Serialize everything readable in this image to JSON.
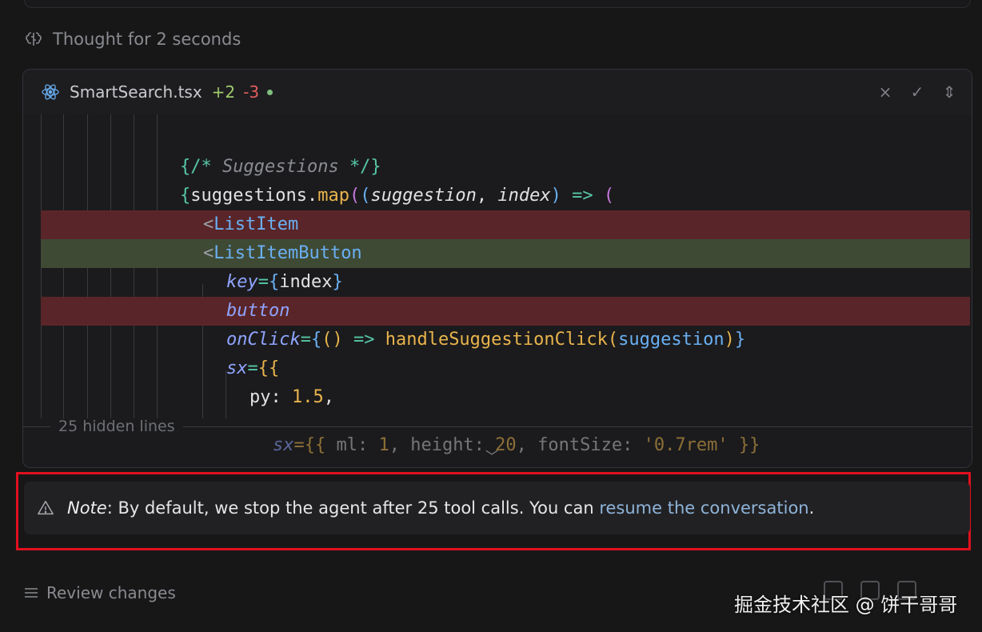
{
  "thought": {
    "label": "Thought for 2 seconds",
    "icon": "brain-icon"
  },
  "editor": {
    "file_name": "SmartSearch.tsx",
    "additions": "+2",
    "deletions": "-3",
    "actions": {
      "reject": "×",
      "accept": "✓",
      "expand": "⇕"
    }
  },
  "code": {
    "l1_a": "{/*",
    "l1_b": " Suggestions ",
    "l1_c": "*/}",
    "l2_a": "{",
    "l2_b": "suggestions.",
    "l2_c": "map",
    "l2_d": "(",
    "l2_e": "(",
    "l2_f": "suggestion",
    "l2_g": ", ",
    "l2_h": "index",
    "l2_i": ")",
    "l2_j": " => ",
    "l2_k": "(",
    "l3_a": "<",
    "l3_b": "ListItem",
    "l4_a": "<",
    "l4_b": "ListItemButton",
    "l5_a": "key",
    "l5_b": "=",
    "l5_c": "{",
    "l5_d": "index",
    "l5_e": "}",
    "l6_a": "button",
    "l7_a": "onClick",
    "l7_b": "=",
    "l7_c": "{",
    "l7_d": "() ",
    "l7_e": "=> ",
    "l7_f": "handleSuggestionClick",
    "l7_g": "(",
    "l7_h": "suggestion",
    "l7_i": ")",
    "l7_j": "}",
    "l8_a": "sx",
    "l8_b": "=",
    "l8_c": "{{",
    "l9_a": "py: ",
    "l9_b": "1.5",
    "l9_c": ",",
    "hidden_label": "25 hidden lines",
    "faded_a": "sx",
    "faded_b": "={{ ",
    "faded_c": "ml: ",
    "faded_d": "1",
    "faded_e": ", height: ",
    "faded_f": "20",
    "faded_g": ", fontSize: ",
    "faded_h": "'0.7rem'",
    "faded_i": " }}"
  },
  "note": {
    "label": "Note",
    "text": ": By default, we stop the agent after 25 tool calls. You can ",
    "link": "resume the conversation",
    "end": "."
  },
  "review": {
    "label": "Review changes"
  },
  "watermark": "掘金技术社区 @ 饼干哥哥"
}
